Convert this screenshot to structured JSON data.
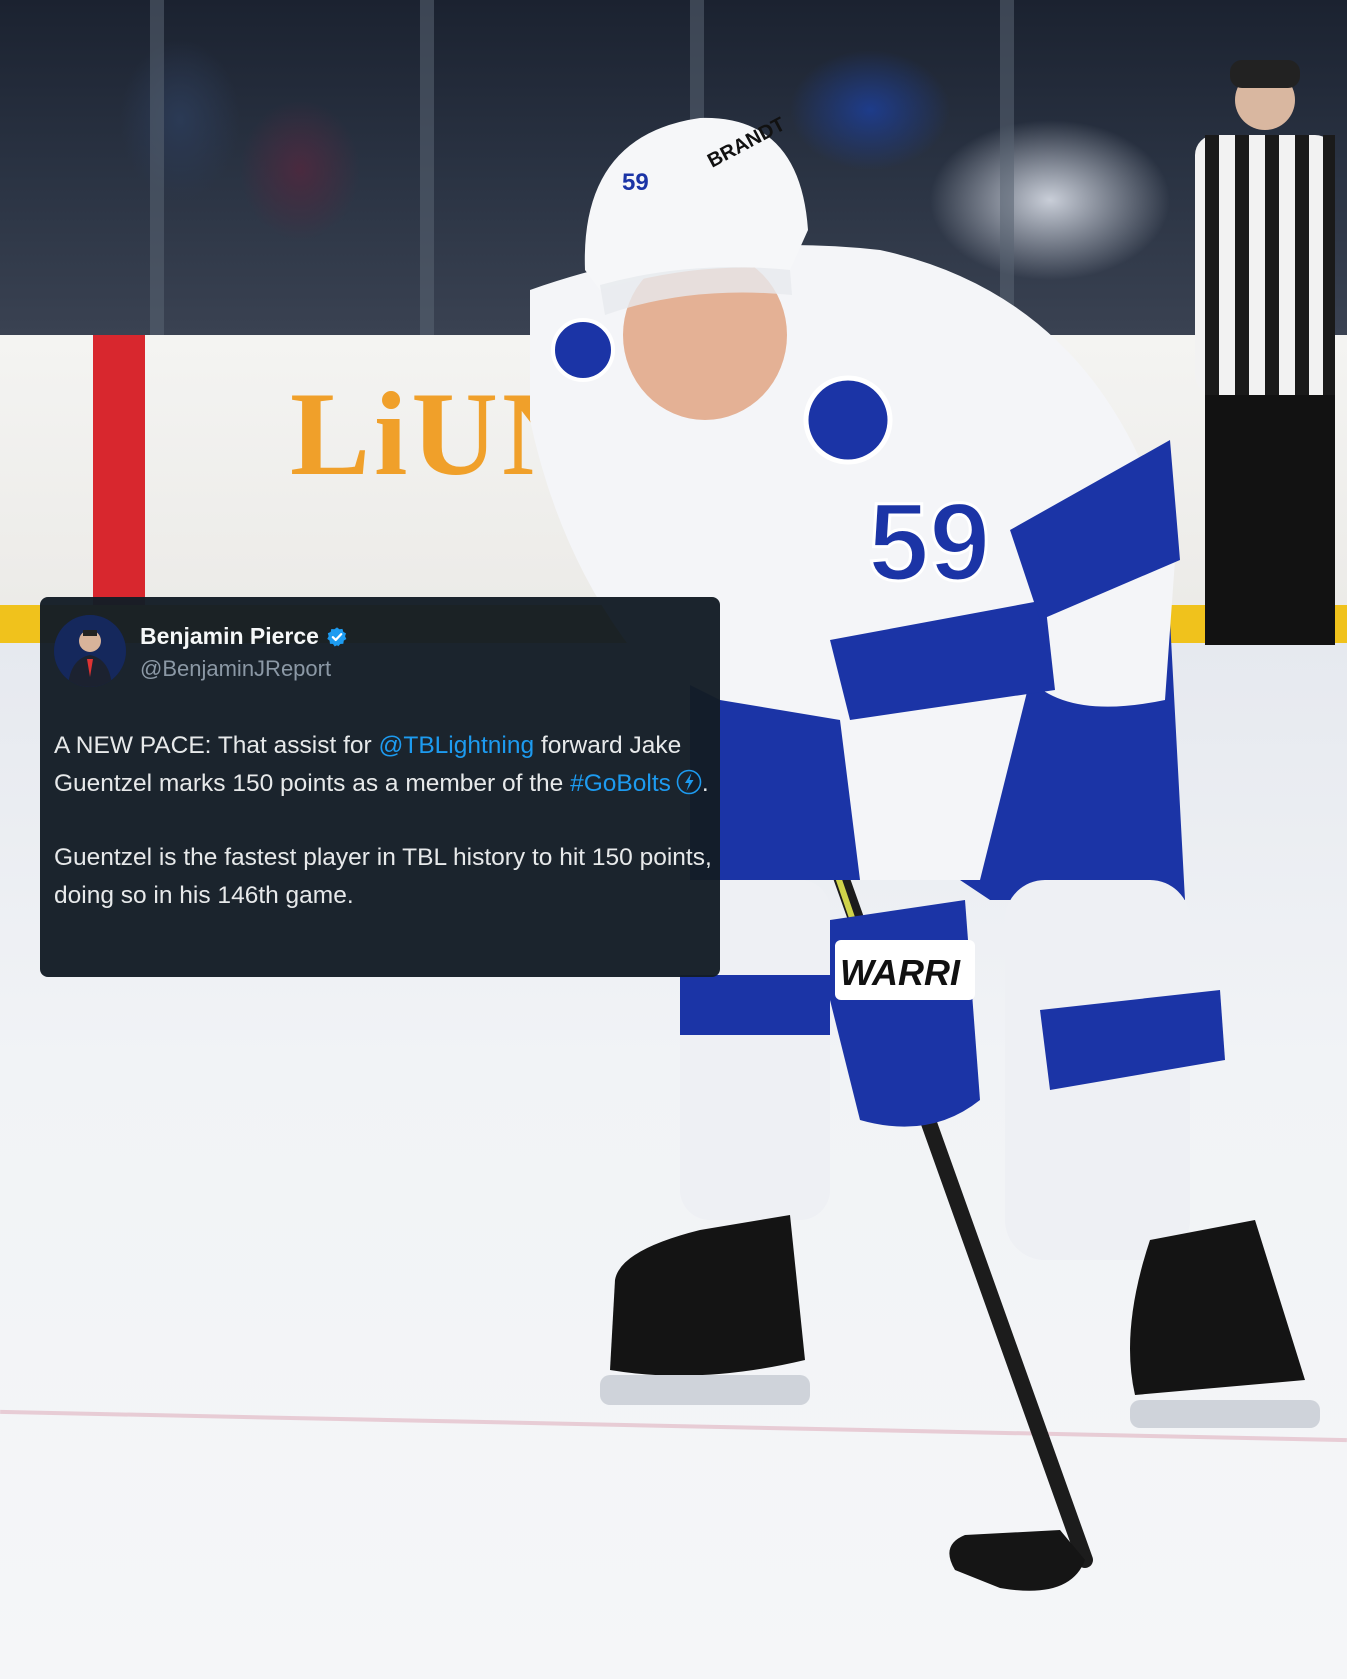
{
  "background": {
    "board_ad": "LiUN",
    "jersey_number": "59",
    "helmet_brand": "BRANDT",
    "glove_brand": "WARRI"
  },
  "tweet": {
    "display_name": "Benjamin Pierce",
    "handle": "@BenjaminJReport",
    "para1": {
      "before_mention": "A NEW PACE: That assist for ",
      "mention": "@TBLightning",
      "after_mention": " forward Jake Guentzel marks 150 points as a member of the ",
      "hashtag": "#GoBolts",
      "after_hashtag": "."
    },
    "para2": "Guentzel is the fastest player in TBL history to hit 150 points, doing so in his 146th game.",
    "icons": [
      "verified-badge-icon",
      "lightning-bolt-emoji-icon"
    ]
  },
  "colors": {
    "card_bg": "#141d26",
    "link": "#1d9bf0",
    "verified": "#1d9bf0",
    "team_blue": "#1b34a6"
  }
}
